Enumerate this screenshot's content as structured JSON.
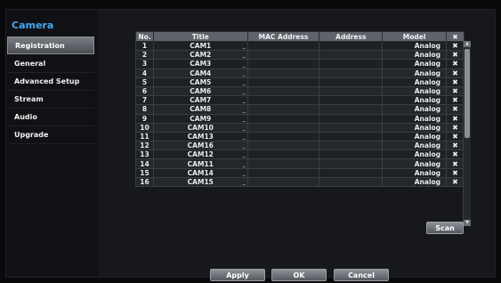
{
  "sidebar": {
    "title": "Camera",
    "items": [
      {
        "label": "Registration",
        "active": true
      },
      {
        "label": "General"
      },
      {
        "label": "Advanced Setup"
      },
      {
        "label": "Stream"
      },
      {
        "label": "Audio"
      },
      {
        "label": "Upgrade"
      }
    ]
  },
  "table": {
    "headers": {
      "no": "No.",
      "title": "Title",
      "mac": "MAC Address",
      "address": "Address",
      "model": "Model",
      "delete": "✖"
    },
    "rows": [
      {
        "no": "1",
        "title": "CAM1",
        "mac": "",
        "address": "",
        "model": "Analog"
      },
      {
        "no": "2",
        "title": "CAM2",
        "mac": "",
        "address": "",
        "model": "Analog"
      },
      {
        "no": "3",
        "title": "CAM3",
        "mac": "",
        "address": "",
        "model": "Analog"
      },
      {
        "no": "4",
        "title": "CAM4",
        "mac": "",
        "address": "",
        "model": "Analog"
      },
      {
        "no": "5",
        "title": "CAM5",
        "mac": "",
        "address": "",
        "model": "Analog"
      },
      {
        "no": "6",
        "title": "CAM6",
        "mac": "",
        "address": "",
        "model": "Analog"
      },
      {
        "no": "7",
        "title": "CAM7",
        "mac": "",
        "address": "",
        "model": "Analog"
      },
      {
        "no": "8",
        "title": "CAM8",
        "mac": "",
        "address": "",
        "model": "Analog"
      },
      {
        "no": "9",
        "title": "CAM9",
        "mac": "",
        "address": "",
        "model": "Analog"
      },
      {
        "no": "10",
        "title": "CAM10",
        "mac": "",
        "address": "",
        "model": "Analog"
      },
      {
        "no": "11",
        "title": "CAM13",
        "mac": "",
        "address": "",
        "model": "Analog"
      },
      {
        "no": "12",
        "title": "CAM16",
        "mac": "",
        "address": "",
        "model": "Analog"
      },
      {
        "no": "13",
        "title": "CAM12",
        "mac": "",
        "address": "",
        "model": "Analog"
      },
      {
        "no": "14",
        "title": "CAM11",
        "mac": "",
        "address": "",
        "model": "Analog"
      },
      {
        "no": "15",
        "title": "CAM14",
        "mac": "",
        "address": "",
        "model": "Analog"
      },
      {
        "no": "16",
        "title": "CAM15",
        "mac": "",
        "address": "",
        "model": "Analog"
      }
    ],
    "title_edit_mark": "_",
    "delete_icon": "✖"
  },
  "buttons": {
    "scan": "Scan",
    "apply": "Apply",
    "ok": "OK",
    "cancel": "Cancel"
  },
  "colors": {
    "accent": "#3fa9f5",
    "header_bg": "#5f636b",
    "panel_bg": "#17181c"
  }
}
